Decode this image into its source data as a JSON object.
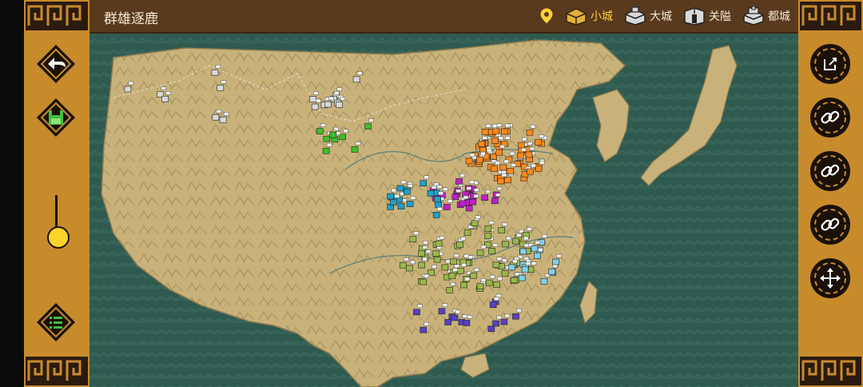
{
  "header": {
    "title": "群雄逐鹿"
  },
  "legend": [
    {
      "id": "marker",
      "label": "",
      "icon": "map-pin-icon"
    },
    {
      "id": "small-city",
      "label": "小城",
      "icon": "small-city-icon",
      "active": true
    },
    {
      "id": "big-city",
      "label": "大城",
      "icon": "big-city-icon"
    },
    {
      "id": "pass",
      "label": "关隘",
      "icon": "pass-icon"
    },
    {
      "id": "capital",
      "label": "都城",
      "icon": "capital-icon"
    }
  ],
  "left_toolbar": [
    {
      "id": "back",
      "icon": "back-arrow-icon"
    },
    {
      "id": "save",
      "icon": "save-icon"
    },
    {
      "id": "list",
      "icon": "list-icon"
    }
  ],
  "zoom_slider": {
    "level": 0.85
  },
  "right_toolbar": [
    {
      "id": "edit",
      "icon": "edit-icon"
    },
    {
      "id": "link1",
      "icon": "link-icon"
    },
    {
      "id": "link2",
      "icon": "link-icon"
    },
    {
      "id": "link3",
      "icon": "link-icon"
    },
    {
      "id": "move",
      "icon": "move-icon"
    }
  ],
  "colors": {
    "panel": "#c78b2c",
    "topbar": "#5a3a1d",
    "sea": "#2f5a50",
    "land": "#c8b27a",
    "active": "#ffcf3a",
    "factions": [
      "#ff8a1c",
      "#c020c8",
      "#1ea0c8",
      "#9ab84a",
      "#3fbf2a",
      "#5a3fc0",
      "#d8d8d8",
      "#7fd0e8"
    ]
  }
}
